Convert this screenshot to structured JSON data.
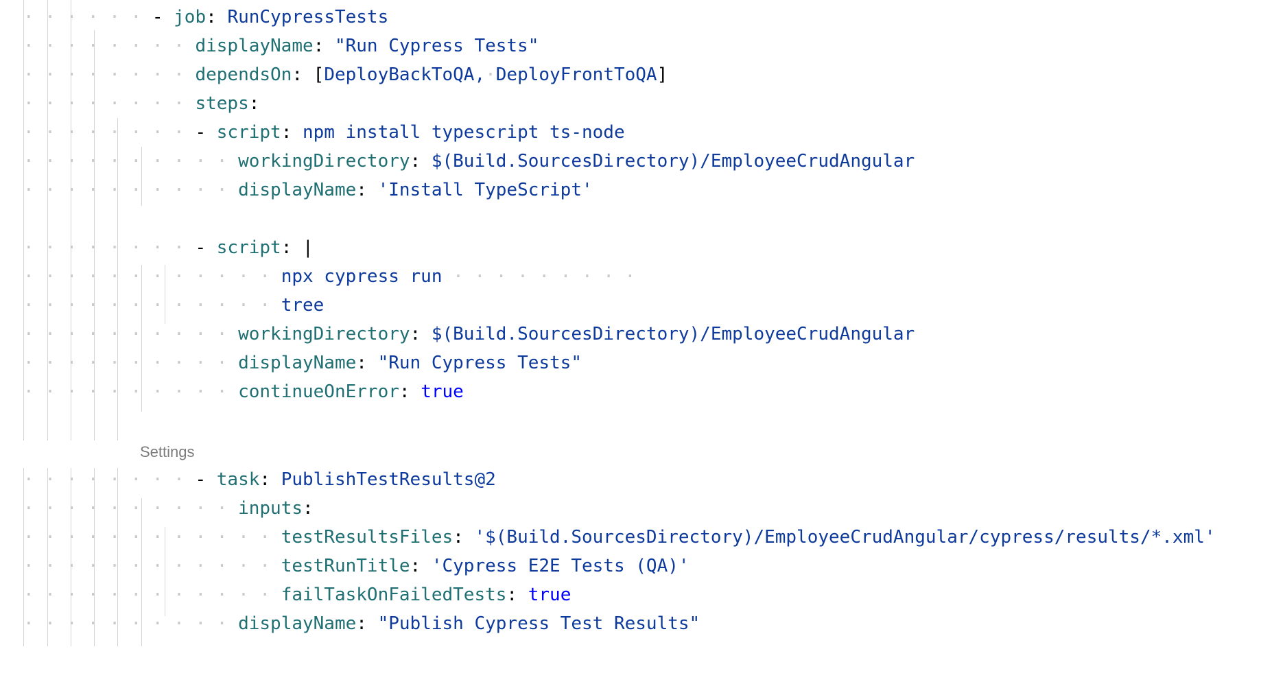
{
  "codelens": {
    "label": "Settings"
  },
  "code": {
    "job_key": "job",
    "job_value": "RunCypressTests",
    "displayName_key": "displayName",
    "displayName_1": "\"Run Cypress Tests\"",
    "dependsOn_key": "dependsOn",
    "dependsOn_open": "[",
    "dependsOn_a": "DeployBackToQA,",
    "dependsOn_b": "DeployFrontToQA",
    "dependsOn_close": "]",
    "steps_key": "steps",
    "script_key": "script",
    "script_1": "npm install typescript ts-node",
    "workingDirectory_key": "workingDirectory",
    "workingDirectory_value": "$(Build.SourcesDirectory)/EmployeeCrudAngular",
    "displayName_2": "'Install TypeScript'",
    "pipe": "|",
    "cmd_1": "npx cypress run",
    "cmd_2": "tree",
    "displayName_3": "\"Run Cypress Tests\"",
    "continueOnError_key": "continueOnError",
    "true_value": "true",
    "task_key": "task",
    "task_value": "PublishTestResults@2",
    "inputs_key": "inputs",
    "testResultsFiles_key": "testResultsFiles",
    "testResultsFiles_value": "'$(Build.SourcesDirectory)/EmployeeCrudAngular/cypress/results/*.xml'",
    "testRunTitle_key": "testRunTitle",
    "testRunTitle_value": "'Cypress E2E Tests (QA)'",
    "failTaskOnFailedTests_key": "failTaskOnFailedTests",
    "displayName_4": "\"Publish Cypress Test Results\""
  }
}
